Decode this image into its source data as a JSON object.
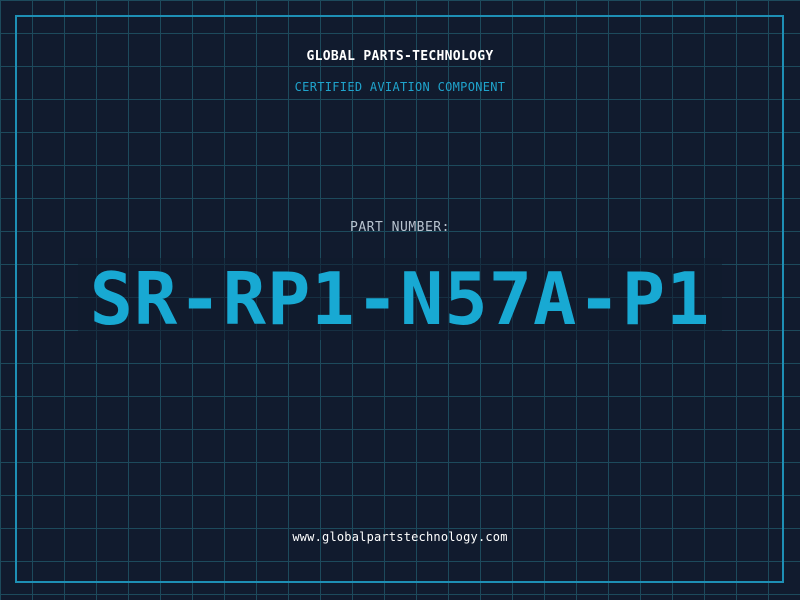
{
  "header": {
    "company": "GLOBAL PARTS-TECHNOLOGY",
    "tagline": "CERTIFIED AVIATION COMPONENT"
  },
  "main": {
    "label": "PART NUMBER:",
    "part_number": "SR-RP1-N57A-P1"
  },
  "footer": {
    "website": "www.globalpartstechnology.com"
  },
  "colors": {
    "background": "#111b2e",
    "grid": "#1d4a5c",
    "frame": "#1e8fb5",
    "accent": "#18a9d3",
    "subtitle": "#1fa3cc",
    "label": "#b8c3cf",
    "text": "#ffffff"
  }
}
